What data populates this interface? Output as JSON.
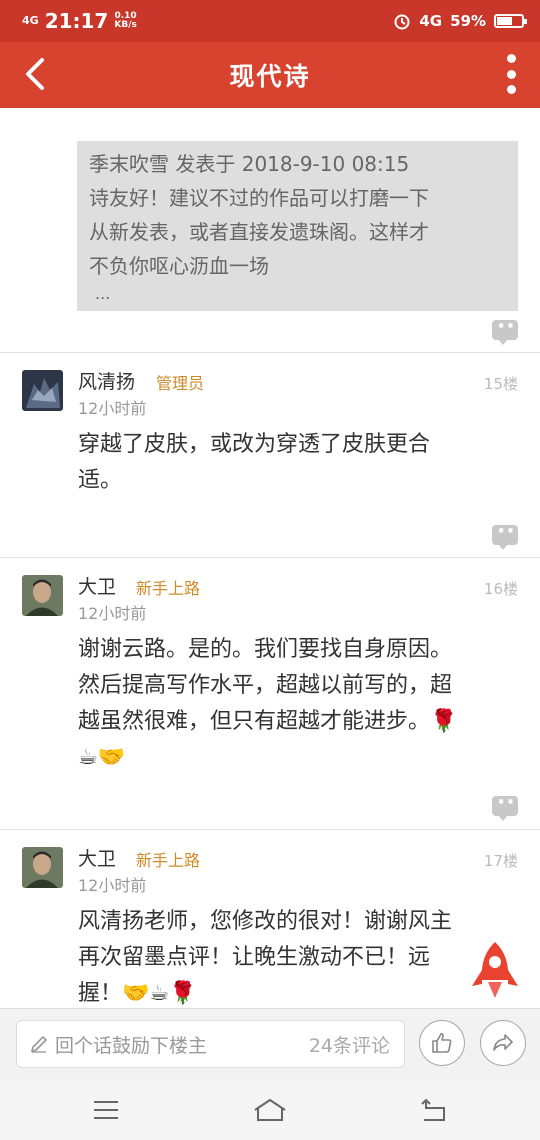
{
  "status_bar": {
    "signal": "4G",
    "time": "21:17",
    "speed_value": "0.10",
    "speed_unit": "KB/s",
    "network": "4G",
    "battery": "59%",
    "battery_level": 0.59
  },
  "header": {
    "title": "现代诗"
  },
  "quoted_post": {
    "line1": "季末吹雪 发表于 2018-9-10 08:15",
    "line2": "诗友好！建议不过的作品可以打磨一下",
    "line3": "从新发表，或者直接发遗珠阁。这样才",
    "line4": "不负你呕心沥血一场",
    "ellipsis": "..."
  },
  "comments": [
    {
      "name": "风清扬",
      "role": "管理员",
      "time": "12小时前",
      "floor": "15楼",
      "lines": [
        "穿越了皮肤，或改为穿透了皮肤更合",
        "适。"
      ]
    },
    {
      "name": "大卫",
      "role": "新手上路",
      "time": "12小时前",
      "floor": "16楼",
      "lines": [
        "谢谢云路。是的。我们要找自身原因。",
        "然后提高写作水平，超越以前写的，超",
        "越虽然很难，但只有超越才能进步。🌹",
        "☕🤝"
      ]
    },
    {
      "name": "大卫",
      "role": "新手上路",
      "time": "12小时前",
      "floor": "17楼",
      "lines": [
        "风清扬老师，您修改的很对！谢谢风主",
        "再次留墨点评！让晚生激动不已！远",
        "握！🤝☕🌹"
      ]
    }
  ],
  "bottom_bar": {
    "input_placeholder": "回个话鼓励下楼主",
    "comment_count": "24条评论"
  },
  "colors": {
    "brand": "#d8432f",
    "role": "#d18a2a"
  }
}
